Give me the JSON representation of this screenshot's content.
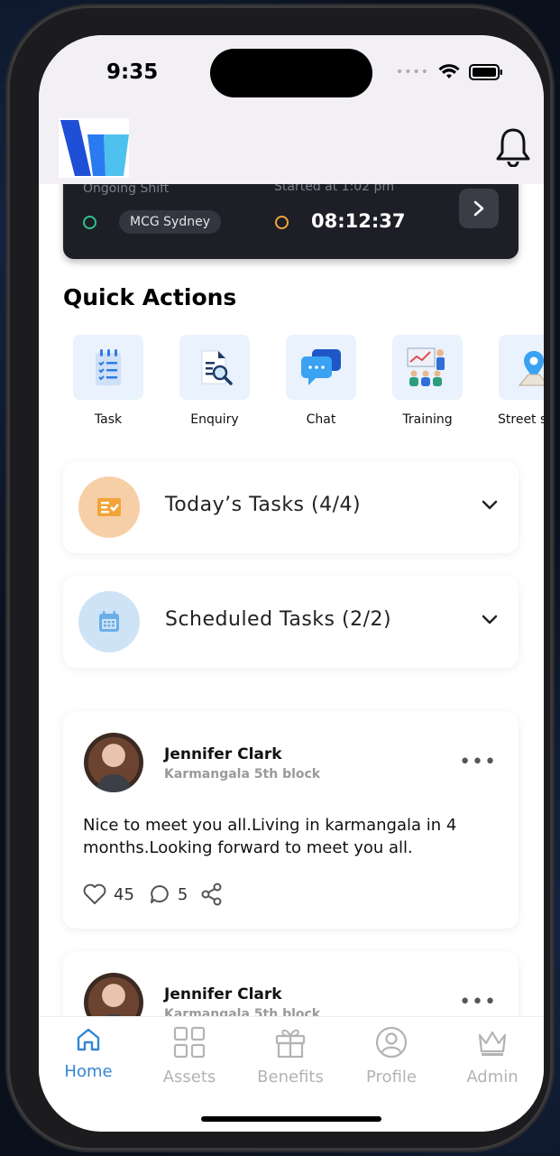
{
  "status": {
    "time": "9:35"
  },
  "shift": {
    "ongoing_label": "Ongoing Shift",
    "location": "MCG Sydney",
    "started_label": "Started at 1:02 pm",
    "timer": "08:12:37"
  },
  "quick_actions": {
    "title": "Quick Actions",
    "items": [
      {
        "label": "Task",
        "icon": "checklist-icon"
      },
      {
        "label": "Enquiry",
        "icon": "document-search-icon"
      },
      {
        "label": "Chat",
        "icon": "chat-bubbles-icon"
      },
      {
        "label": "Training",
        "icon": "presentation-icon"
      },
      {
        "label": "Street s",
        "icon": "map-pin-icon"
      }
    ]
  },
  "tasks": [
    {
      "label": "Today’s Tasks (4/4)",
      "icon": "task-checklist-icon",
      "color": "#f7cfa6"
    },
    {
      "label": "Scheduled Tasks (2/2)",
      "icon": "calendar-icon",
      "color": "#cfe3f6"
    }
  ],
  "posts": [
    {
      "name": "Jennifer Clark",
      "location": "Karmangala 5th block",
      "text": "Nice to meet you all.Living in karmangala in 4 months.Looking forward to meet you all.",
      "likes": "45",
      "comments": "5"
    },
    {
      "name": "Jennifer Clark",
      "location": "Karmangala 5th block"
    }
  ],
  "nav": {
    "items": [
      {
        "label": "Home",
        "icon": "home-icon"
      },
      {
        "label": "Assets",
        "icon": "grid-icon"
      },
      {
        "label": "Benefits",
        "icon": "gift-icon"
      },
      {
        "label": "Profile",
        "icon": "user-circle-icon"
      },
      {
        "label": "Admin",
        "icon": "crown-icon"
      }
    ],
    "active": "Home"
  },
  "colors": {
    "accent": "#3486d6",
    "shift_card": "#1e1f26",
    "header_bg": "#f2eff5"
  }
}
